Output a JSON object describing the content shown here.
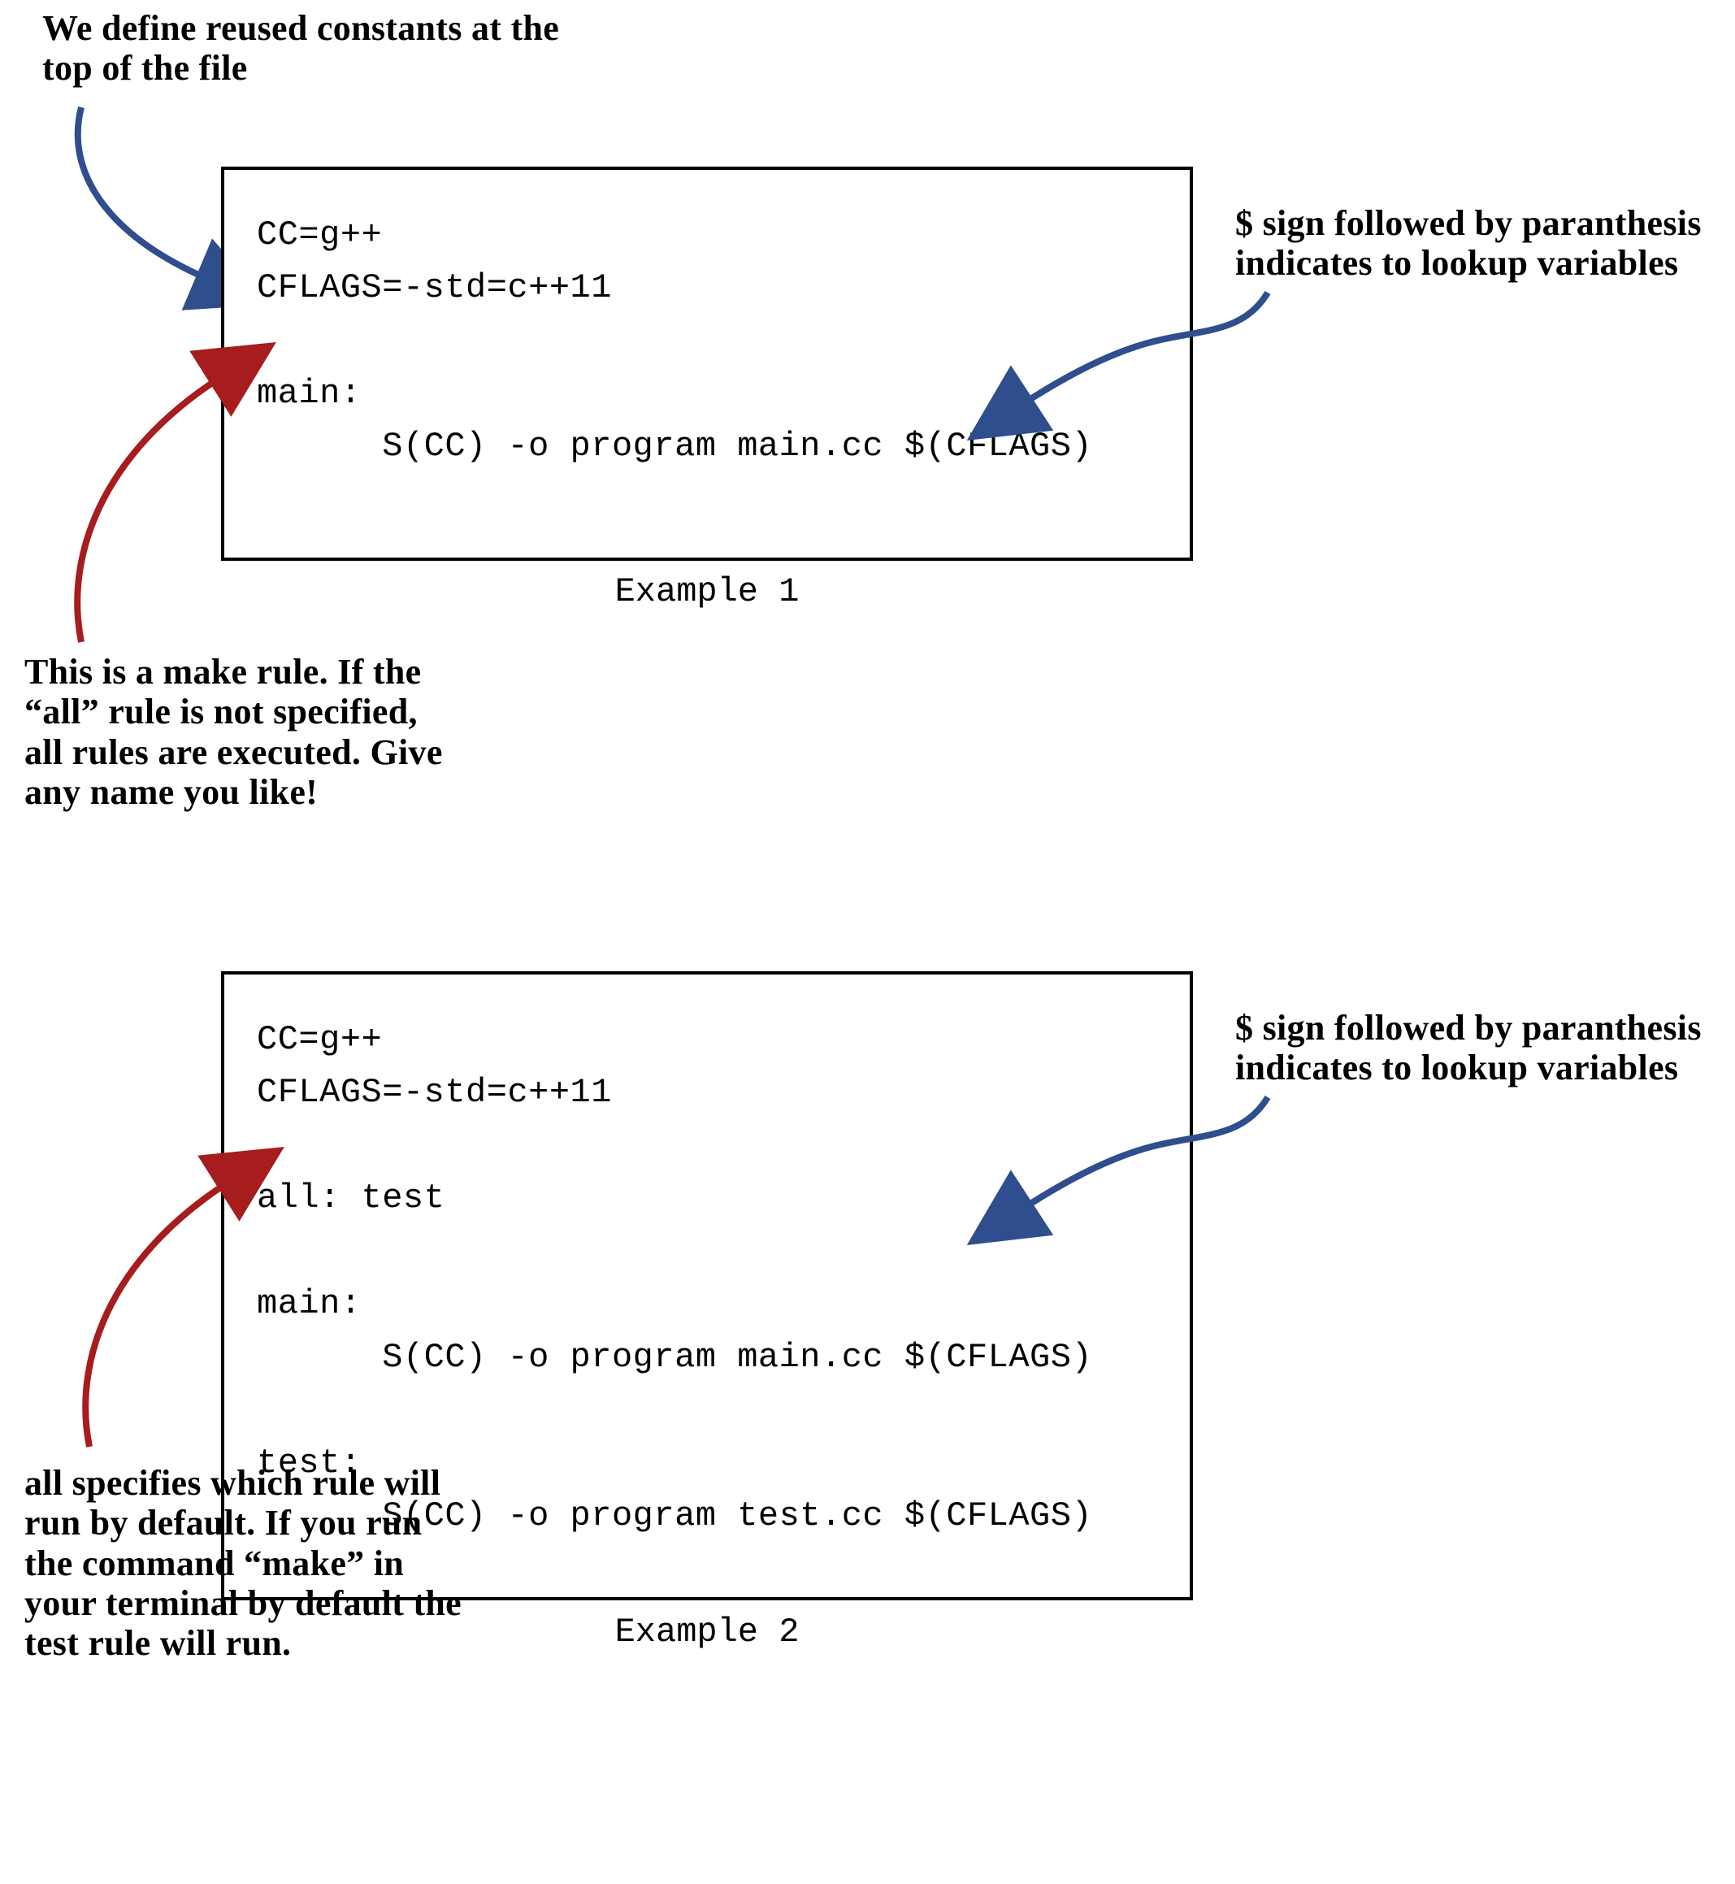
{
  "annotations": {
    "top_constants": "We define reused constants\nat the top of the file",
    "dollar_lookup": "$ sign followed by paranthesis\nindicates to lookup variables",
    "make_rule": "This is a make\nrule. If the “all”\nrule is not specified,\nall rules are executed.\nGive any name you like!",
    "all_specifies": "all specifies\nwhich rule\nwill run by\ndefault.\nIf you run the\ncommand “make” in\nyour terminal by default\nthe test rule will run."
  },
  "example1": {
    "caption": "Example 1",
    "code": "CC=g++\nCFLAGS=-std=c++11\n\nmain:\n      S(CC) -o program main.cc $(CFLAGS)"
  },
  "example2": {
    "caption": "Example 2",
    "code": "CC=g++\nCFLAGS=-std=c++11\n\nall: test\n\nmain:\n      S(CC) -o program main.cc $(CFLAGS)\n\ntest:\n      S(CC) -o program test.cc $(CFLAGS)"
  },
  "colors": {
    "arrow_blue": "#2e4e8e",
    "arrow_red": "#a71c1c"
  }
}
